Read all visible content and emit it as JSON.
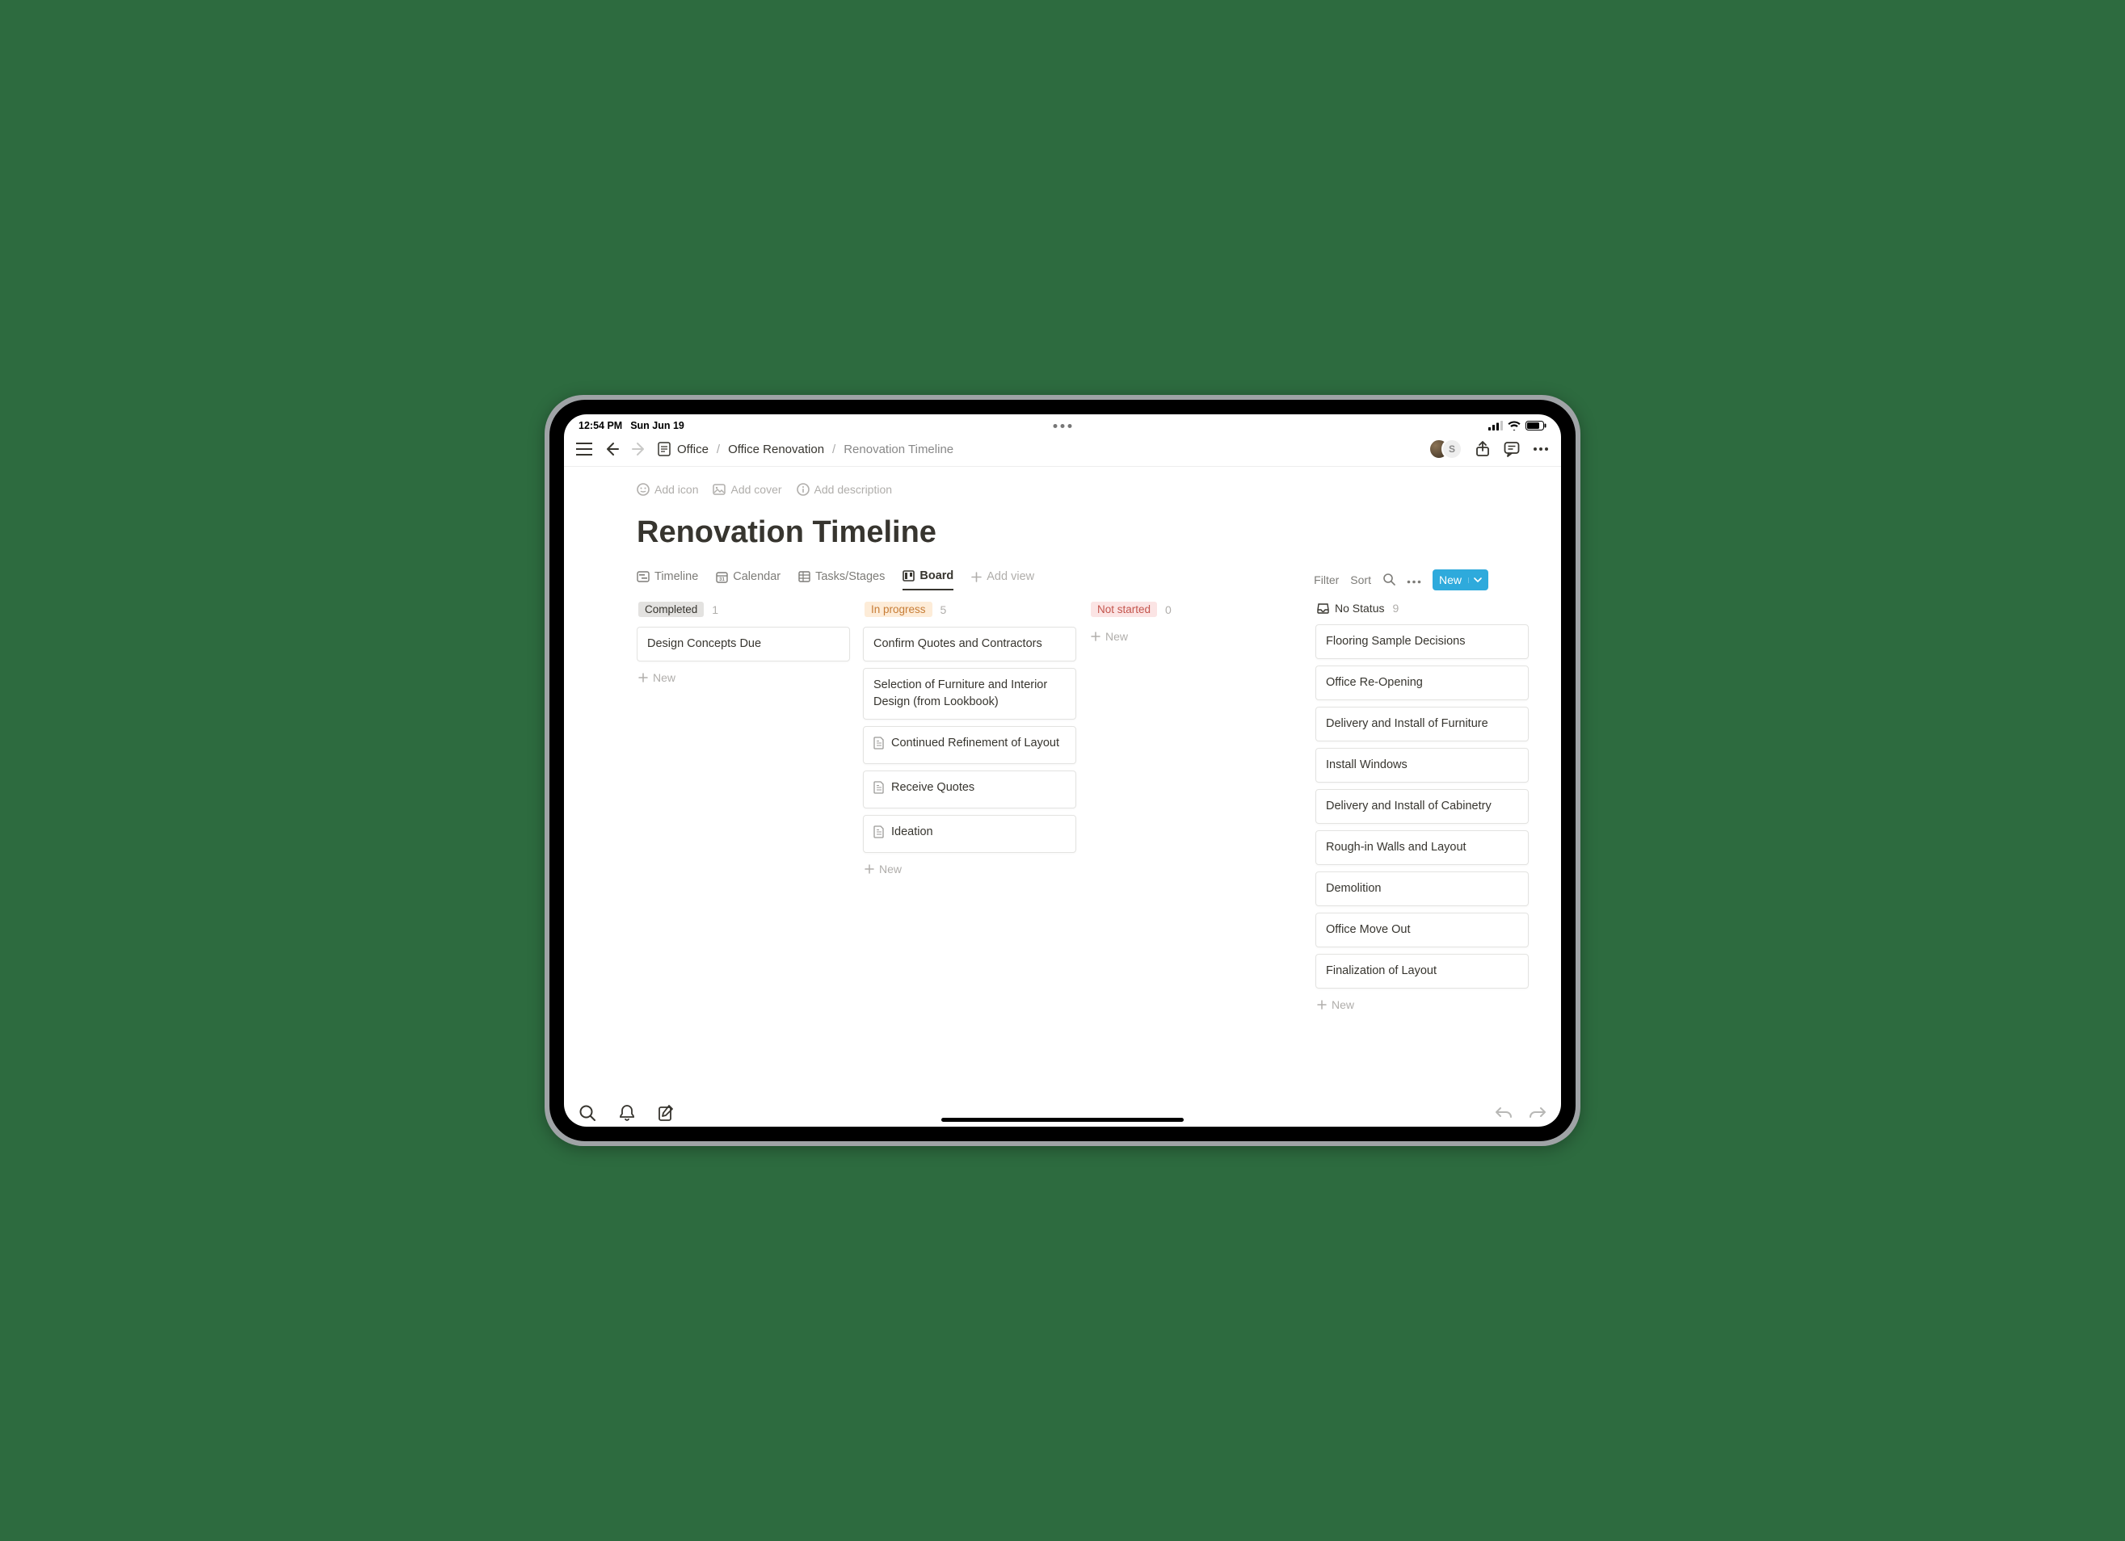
{
  "status_bar": {
    "time": "12:54 PM",
    "date": "Sun Jun 19"
  },
  "breadcrumb": {
    "root": "Office",
    "parent": "Office Renovation",
    "current": "Renovation Timeline"
  },
  "page_actions": {
    "add_icon": "Add icon",
    "add_cover": "Add cover",
    "add_description": "Add description"
  },
  "title": "Renovation Timeline",
  "views": {
    "timeline": "Timeline",
    "calendar": "Calendar",
    "tasks": "Tasks/Stages",
    "board": "Board",
    "add": "Add view"
  },
  "controls": {
    "filter": "Filter",
    "sort": "Sort",
    "new": "New"
  },
  "board_columns": {
    "completed": {
      "label": "Completed",
      "count": "1",
      "cards": [
        {
          "title": "Design Concepts Due"
        }
      ],
      "new_label": "New"
    },
    "in_progress": {
      "label": "In progress",
      "count": "5",
      "cards": [
        {
          "title": "Confirm Quotes and Contractors"
        },
        {
          "title": "Selection of Furniture and Interior Design (from Lookbook)"
        },
        {
          "title": "Continued Refinement of Layout",
          "doc": true
        },
        {
          "title": "Receive Quotes",
          "doc": true
        },
        {
          "title": "Ideation",
          "doc": true
        }
      ],
      "new_label": "New"
    },
    "not_started": {
      "label": "Not started",
      "count": "0",
      "cards": [],
      "new_label": "New"
    },
    "no_status": {
      "label": "No Status",
      "count": "9",
      "cards": [
        {
          "title": "Flooring Sample Decisions"
        },
        {
          "title": "Office Re-Opening"
        },
        {
          "title": "Delivery and Install of Furniture"
        },
        {
          "title": "Install Windows"
        },
        {
          "title": "Delivery and Install of Cabinetry"
        },
        {
          "title": "Rough-in Walls and Layout"
        },
        {
          "title": "Demolition"
        },
        {
          "title": "Office Move Out"
        },
        {
          "title": "Finalization of Layout"
        }
      ],
      "new_label": "New"
    }
  },
  "avatar2_initial": "S"
}
